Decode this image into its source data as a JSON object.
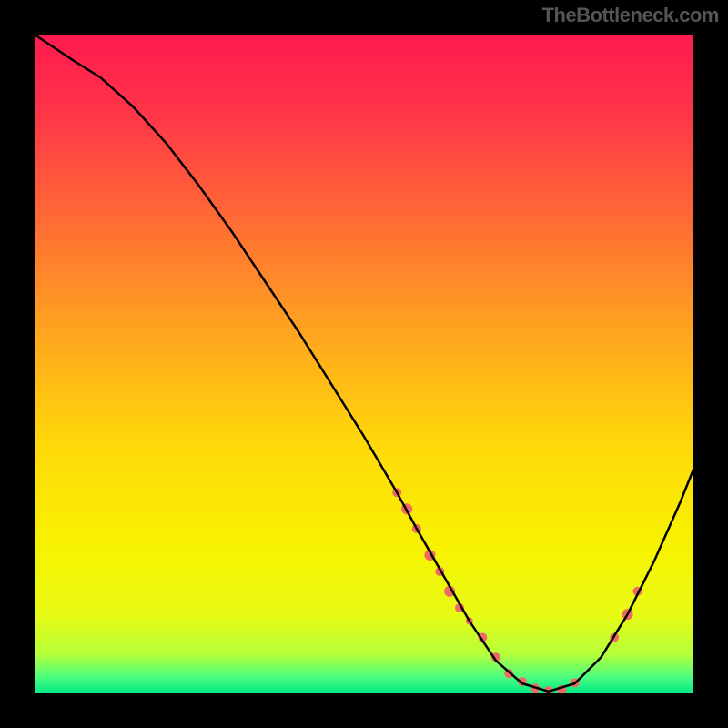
{
  "attribution": "TheBottleneck.com",
  "chart_data": {
    "type": "line",
    "title": "",
    "xlabel": "",
    "ylabel": "",
    "xlim": [
      0,
      100
    ],
    "ylim": [
      0,
      100
    ],
    "background_gradient": {
      "stops": [
        {
          "offset": 0.0,
          "color": "#ff1a4f"
        },
        {
          "offset": 0.12,
          "color": "#ff3548"
        },
        {
          "offset": 0.28,
          "color": "#ff6a35"
        },
        {
          "offset": 0.45,
          "color": "#ffa41f"
        },
        {
          "offset": 0.62,
          "color": "#ffd80a"
        },
        {
          "offset": 0.78,
          "color": "#f7f300"
        },
        {
          "offset": 0.88,
          "color": "#e8fb14"
        },
        {
          "offset": 0.94,
          "color": "#b6ff3a"
        },
        {
          "offset": 0.975,
          "color": "#4dff7e"
        },
        {
          "offset": 1.0,
          "color": "#00e887"
        }
      ]
    },
    "series": [
      {
        "name": "bottleneck-curve",
        "color": "#000000",
        "x": [
          0,
          3,
          6,
          10,
          15,
          20,
          25,
          30,
          35,
          40,
          45,
          50,
          55,
          58,
          62,
          66,
          70,
          74,
          78,
          82,
          86,
          90,
          94,
          98,
          100
        ],
        "y": [
          100,
          98,
          96,
          93.5,
          89,
          83.5,
          77,
          70,
          62.5,
          55,
          47,
          39,
          30.5,
          25,
          18,
          11,
          5,
          1.5,
          0.3,
          1.5,
          5.5,
          12,
          20,
          29,
          34
        ]
      }
    ],
    "scatter": [
      {
        "name": "marker-cluster-left",
        "color": "#ee6a63",
        "points": [
          {
            "x": 55,
            "y": 30.5,
            "r": 5
          },
          {
            "x": 56.5,
            "y": 28,
            "r": 6
          },
          {
            "x": 58,
            "y": 25,
            "r": 5
          },
          {
            "x": 60,
            "y": 21,
            "r": 6
          },
          {
            "x": 61.5,
            "y": 18.5,
            "r": 5
          },
          {
            "x": 63,
            "y": 15.5,
            "r": 6
          },
          {
            "x": 64.5,
            "y": 13,
            "r": 5
          }
        ]
      },
      {
        "name": "marker-cluster-bottom",
        "color": "#ee6a63",
        "points": [
          {
            "x": 66,
            "y": 11,
            "r": 4
          },
          {
            "x": 68,
            "y": 8.5,
            "r": 5
          },
          {
            "x": 70,
            "y": 5.5,
            "r": 5
          },
          {
            "x": 72,
            "y": 3,
            "r": 5
          },
          {
            "x": 74,
            "y": 1.8,
            "r": 5
          },
          {
            "x": 76,
            "y": 0.8,
            "r": 5
          },
          {
            "x": 78,
            "y": 0.4,
            "r": 5
          },
          {
            "x": 80,
            "y": 0.6,
            "r": 5
          },
          {
            "x": 82,
            "y": 1.6,
            "r": 5
          }
        ]
      },
      {
        "name": "marker-cluster-right",
        "color": "#ee6a63",
        "points": [
          {
            "x": 88,
            "y": 8.5,
            "r": 5
          },
          {
            "x": 90,
            "y": 12,
            "r": 6
          },
          {
            "x": 91.5,
            "y": 15.5,
            "r": 5
          }
        ]
      }
    ]
  }
}
